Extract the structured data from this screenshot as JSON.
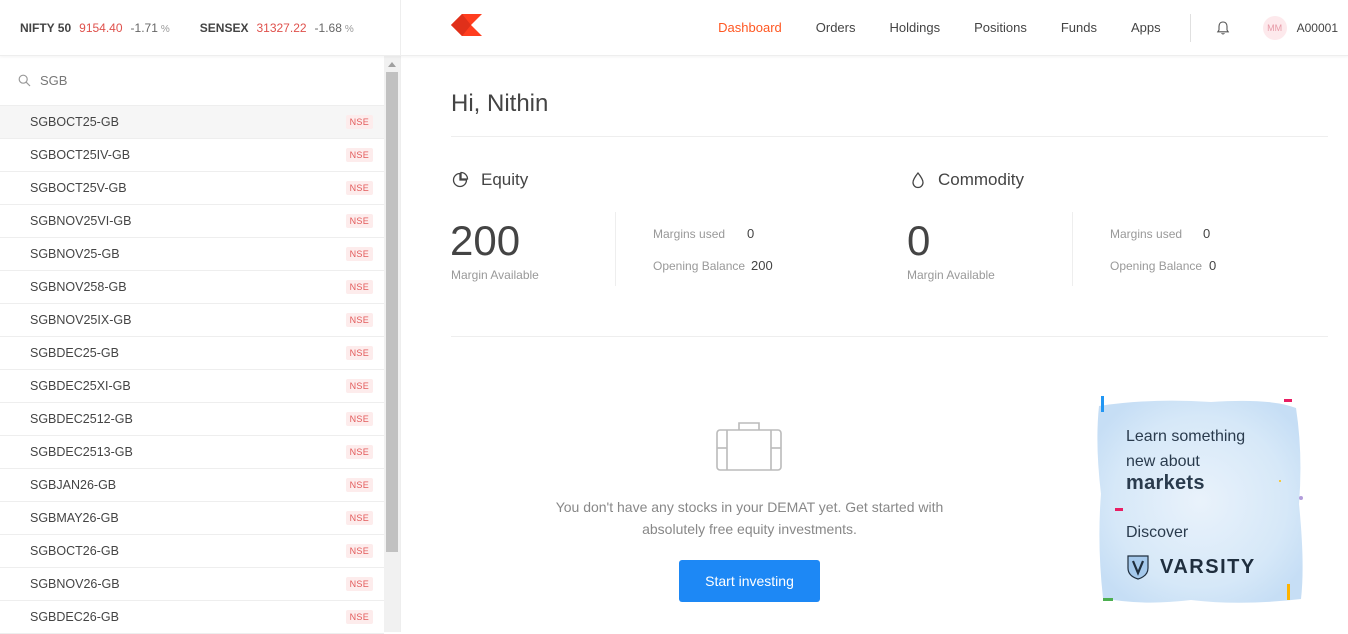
{
  "header": {
    "indices": [
      {
        "name": "NIFTY 50",
        "value": "9154.40",
        "change": "-1.71",
        "unit": "%"
      },
      {
        "name": "SENSEX",
        "value": "31327.22",
        "change": "-1.68",
        "unit": "%"
      }
    ],
    "nav": [
      "Dashboard",
      "Orders",
      "Holdings",
      "Positions",
      "Funds",
      "Apps"
    ],
    "active_nav": "Dashboard",
    "avatar_initials": "MM",
    "user_id": "A00001"
  },
  "sidebar": {
    "search_value": "SGB",
    "items": [
      {
        "symbol": "SGBOCT25-GB",
        "exchange": "NSE"
      },
      {
        "symbol": "SGBOCT25IV-GB",
        "exchange": "NSE"
      },
      {
        "symbol": "SGBOCT25V-GB",
        "exchange": "NSE"
      },
      {
        "symbol": "SGBNOV25VI-GB",
        "exchange": "NSE"
      },
      {
        "symbol": "SGBNOV25-GB",
        "exchange": "NSE"
      },
      {
        "symbol": "SGBNOV258-GB",
        "exchange": "NSE"
      },
      {
        "symbol": "SGBNOV25IX-GB",
        "exchange": "NSE"
      },
      {
        "symbol": "SGBDEC25-GB",
        "exchange": "NSE"
      },
      {
        "symbol": "SGBDEC25XI-GB",
        "exchange": "NSE"
      },
      {
        "symbol": "SGBDEC2512-GB",
        "exchange": "NSE"
      },
      {
        "symbol": "SGBDEC2513-GB",
        "exchange": "NSE"
      },
      {
        "symbol": "SGBJAN26-GB",
        "exchange": "NSE"
      },
      {
        "symbol": "SGBMAY26-GB",
        "exchange": "NSE"
      },
      {
        "symbol": "SGBOCT26-GB",
        "exchange": "NSE"
      },
      {
        "symbol": "SGBNOV26-GB",
        "exchange": "NSE"
      },
      {
        "symbol": "SGBDEC26-GB",
        "exchange": "NSE"
      }
    ]
  },
  "main": {
    "greeting": "Hi, Nithin",
    "equity": {
      "title": "Equity",
      "margin_available": "200",
      "margin_available_label": "Margin Available",
      "margins_used_label": "Margins used",
      "margins_used": "0",
      "opening_balance_label": "Opening Balance",
      "opening_balance": "200"
    },
    "commodity": {
      "title": "Commodity",
      "margin_available": "0",
      "margin_available_label": "Margin Available",
      "margins_used_label": "Margins used",
      "margins_used": "0",
      "opening_balance_label": "Opening Balance",
      "opening_balance": "0"
    },
    "empty_message": "You don't have any stocks in your DEMAT yet. Get started with absolutely free equity investments.",
    "cta_label": "Start investing",
    "varsity": {
      "line1": "Learn something",
      "line2": "new about",
      "line3": "markets",
      "line4": "Discover",
      "brand": "VARSITY"
    }
  },
  "colors": {
    "accent": "#ff5722",
    "negative": "#df514c",
    "button": "#1d88f5",
    "badge_text": "#e25a5a",
    "badge_bg": "#fdecec"
  }
}
